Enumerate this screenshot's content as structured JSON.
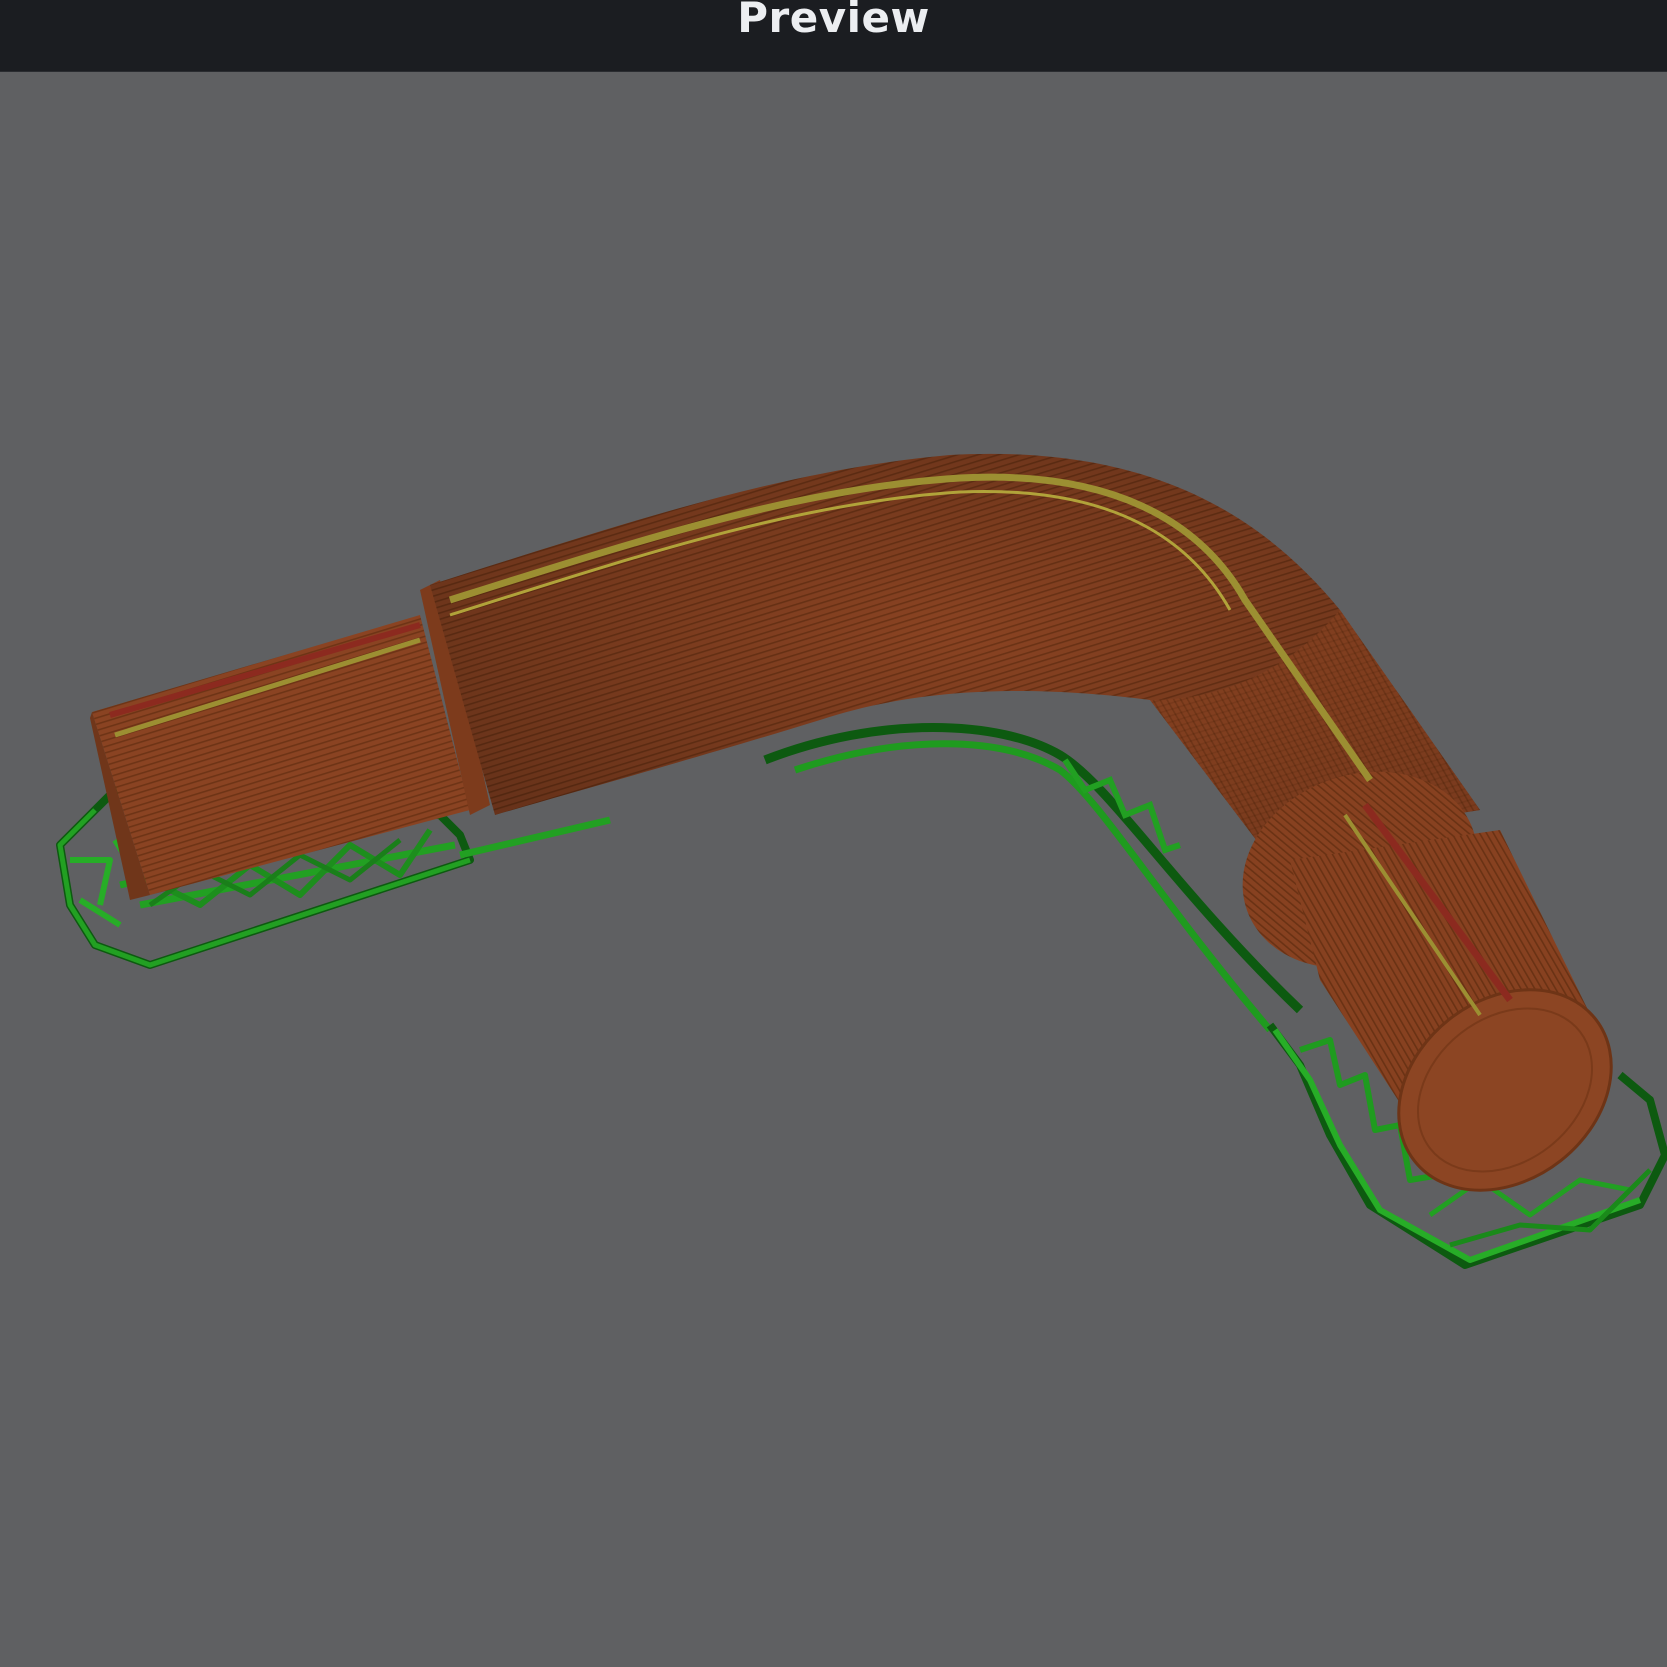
{
  "header": {
    "title": "Preview"
  },
  "viewport": {
    "background_color": "#5f6062",
    "model": {
      "part_color": "#8a4322",
      "layer_line_color": "#6e3416",
      "highlight_yellow": "#9c8f32",
      "highlight_red": "#8c2a1f",
      "support_color": "#1f8f1f",
      "support_dark": "#0d5a10"
    }
  },
  "icons": {
    "support-lattice": "support-icon"
  }
}
